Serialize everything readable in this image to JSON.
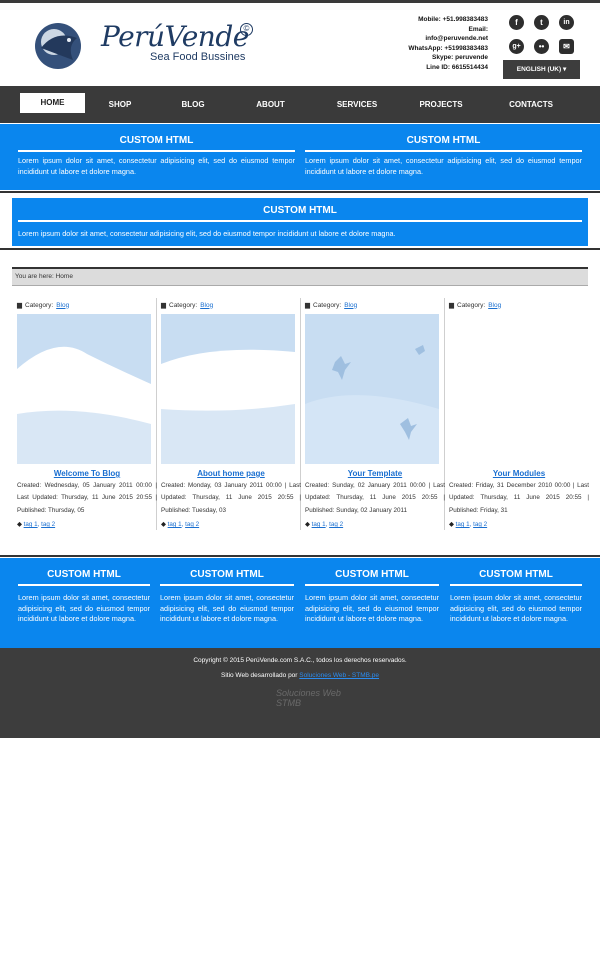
{
  "brand": {
    "name": "PerúVende",
    "copyright_symbol": "©",
    "tagline": "Sea Food Bussines"
  },
  "contact": {
    "lines": [
      "Mobile: +51.998383483",
      "Email:",
      "info@peruvende.net",
      "WhatsApp: +51998383483",
      "Skype: peruvende",
      "Line ID: 6615514434"
    ]
  },
  "social": {
    "icons": [
      "f",
      "t",
      "in",
      "g+",
      "•• ",
      "✉"
    ]
  },
  "language": {
    "selected": "ENGLISH (UK)"
  },
  "nav": {
    "items": [
      "HOME",
      "SHOP",
      "BLOG",
      "ABOUT",
      "SERVICES",
      "PROJECTS",
      "CONTACTS"
    ],
    "active": "HOME"
  },
  "modules_top": [
    {
      "title": "CUSTOM HTML",
      "text": "Lorem ipsum dolor sit amet, consectetur adipisicing elit, sed do eiusmod tempor incididunt ut labore et dolore magna."
    },
    {
      "title": "CUSTOM HTML",
      "text": "Lorem ipsum dolor sit amet, consectetur adipisicing elit, sed do eiusmod tempor incididunt ut labore et dolore magna."
    }
  ],
  "module_full": {
    "title": "CUSTOM HTML",
    "text": "Lorem ipsum dolor sit amet, consectetur adipisicing elit, sed do eiusmod tempor incididunt ut labore et dolore magna."
  },
  "breadcrumb": {
    "text": "You are here: Home"
  },
  "articles": [
    {
      "category_label": "Category:",
      "category": "Blog",
      "title": "Welcome To Blog",
      "meta": "Created: Wednesday, 05 January 2011 00:00 | Last Updated: Thursday, 11 June 2015 20:55 | Published: Thursday, 05",
      "tag1": "tag 1",
      "tag2": "tag 2"
    },
    {
      "category_label": "Category:",
      "category": "Blog",
      "title": "About home page",
      "meta": "Created: Monday, 03 January 2011 00:00 | Last Updated: Thursday, 11 June 2015 20:55 | Published: Tuesday, 03",
      "tag1": "tag 1",
      "tag2": "tag 2"
    },
    {
      "category_label": "Category:",
      "category": "Blog",
      "title": "Your Template",
      "meta": "Created: Sunday, 02 January 2011 00:00 | Last Updated: Thursday, 11 June 2015 20:55 | Published: Sunday, 02 January 2011",
      "tag1": "tag 1",
      "tag2": "tag 2"
    },
    {
      "category_label": "Category:",
      "category": "Blog",
      "title": "Your Modules",
      "meta": "Created: Friday, 31 December 2010 00:00 | Last Updated: Thursday, 11 June 2015 20:55 | Published: Friday, 31",
      "tag1": "tag 1",
      "tag2": "tag 2"
    }
  ],
  "modules_bottom": [
    {
      "title": "CUSTOM HTML",
      "text": "Lorem ipsum dolor sit amet, consectetur adipisicing elit, sed do eiusmod tempor incididunt ut labore et dolore magna."
    },
    {
      "title": "CUSTOM HTML",
      "text": "Lorem ipsum dolor sit amet, consectetur adipisicing elit, sed do eiusmod tempor incididunt ut labore et dolore magna."
    },
    {
      "title": "CUSTOM HTML",
      "text": "Lorem ipsum dolor sit amet, consectetur adipisicing elit, sed do eiusmod tempor incididunt ut labore et dolore magna."
    },
    {
      "title": "CUSTOM HTML",
      "text": "Lorem ipsum dolor sit amet, consectetur adipisicing elit, sed do eiusmod tempor incididunt ut labore et dolore magna."
    }
  ],
  "footer": {
    "copyright": "Copyright © 2015 PerúVende.com S.A.C., todos los derechos reservados.",
    "credit_prefix": "Sitio Web desarrollado por",
    "credit_link": "Soluciones Web - STMB.pe",
    "mark": "Soluciones Web STMB"
  },
  "colors": {
    "accent": "#0a86ee",
    "dark": "#3a3a3a",
    "link": "#1a6fd0"
  }
}
